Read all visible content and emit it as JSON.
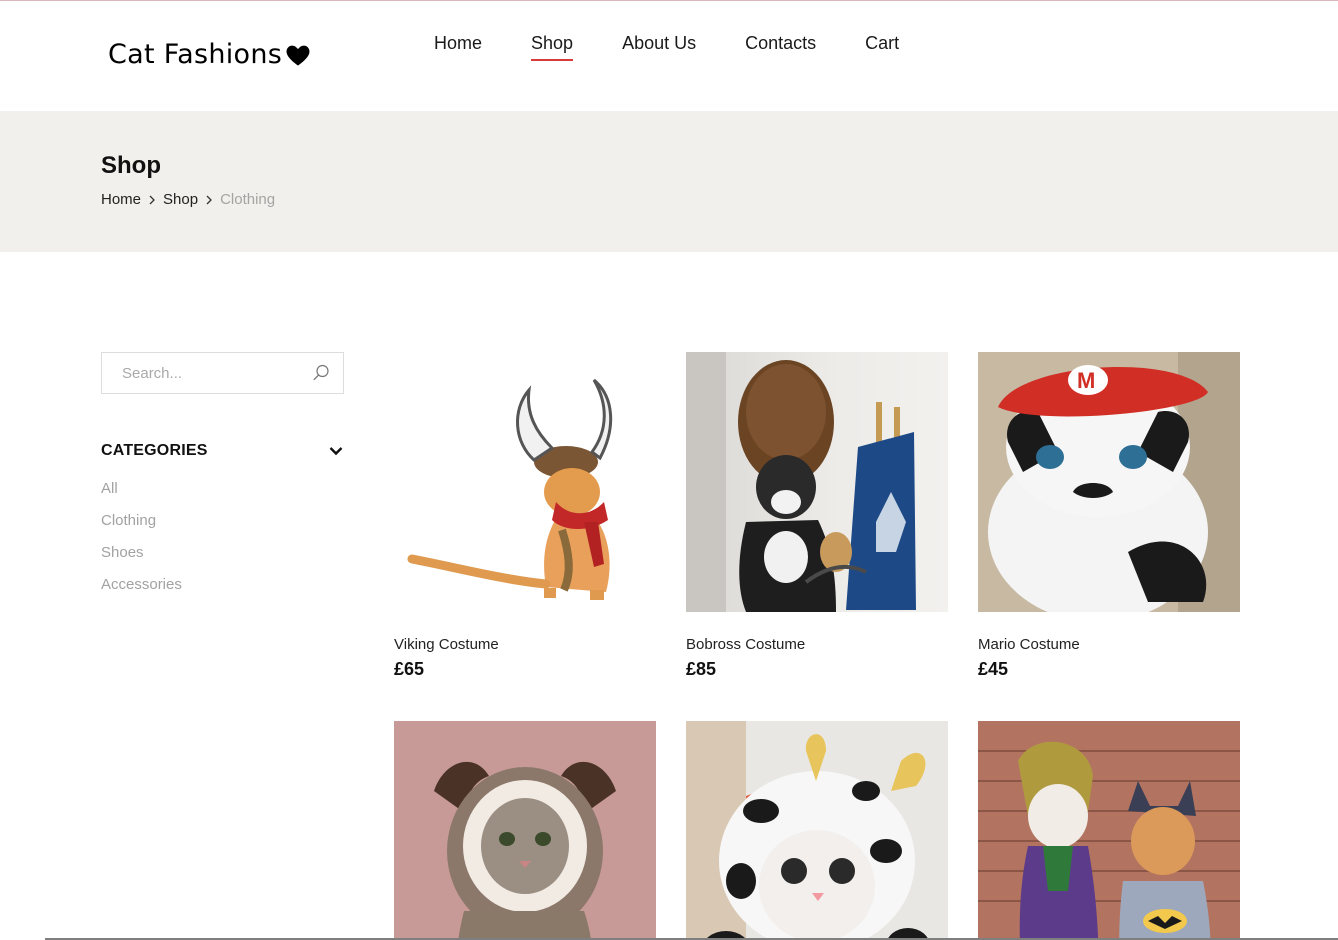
{
  "brand": {
    "name": "Cat Fashions",
    "heart_icon": "heart-icon"
  },
  "nav": [
    {
      "label": "Home",
      "active": false
    },
    {
      "label": "Shop",
      "active": true
    },
    {
      "label": "About Us",
      "active": false
    },
    {
      "label": "Contacts",
      "active": false
    },
    {
      "label": "Cart",
      "active": false
    }
  ],
  "banner": {
    "title": "Shop",
    "breadcrumb": [
      "Home",
      "Shop",
      "Clothing"
    ]
  },
  "sidebar": {
    "search_placeholder": "Search...",
    "categories_title": "CATEGORIES",
    "categories": [
      "All",
      "Clothing",
      "Shoes",
      "Accessories"
    ]
  },
  "products": [
    {
      "name": "Viking Costume",
      "price": "£65"
    },
    {
      "name": "Bobross Costume",
      "price": "£85"
    },
    {
      "name": "Mario Costume",
      "price": "£45"
    },
    {
      "name": "",
      "price": ""
    },
    {
      "name": "",
      "price": ""
    },
    {
      "name": "",
      "price": ""
    }
  ],
  "colors": {
    "accent": "#d63a3a",
    "banner_bg": "#f1f0ec",
    "muted_text": "#a2a2a2"
  }
}
